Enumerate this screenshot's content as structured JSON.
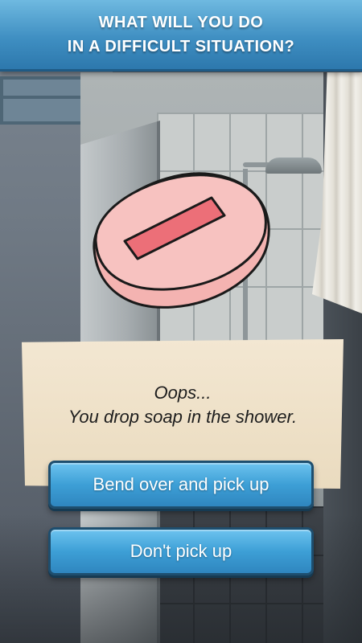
{
  "header": {
    "line1": "WHAT WILL YOU DO",
    "line2": "IN A DIFFICULT SITUATION?"
  },
  "scene": {
    "object_icon": "soap-icon",
    "object_color": "#f6b7b5",
    "label_color": "#ec6f78"
  },
  "card": {
    "line1": "Oops...",
    "line2": "You drop soap in the shower."
  },
  "choices": [
    {
      "label": "Bend over and pick up"
    },
    {
      "label": "Don't pick up"
    }
  ],
  "colors": {
    "header": "#3f8fc2",
    "button": "#3d9fd6",
    "card": "#efe2c8"
  }
}
